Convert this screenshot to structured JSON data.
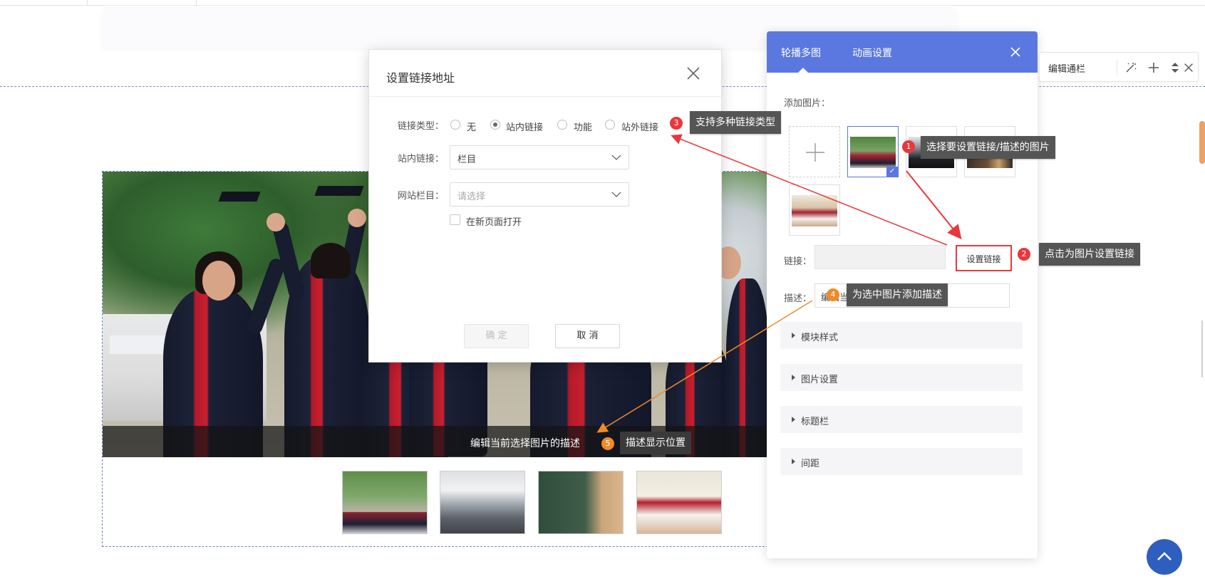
{
  "dialog": {
    "title": "设置链接地址",
    "link_type_label": "链接类型：",
    "link_types": [
      "无",
      "站内链接",
      "功能",
      "站外链接"
    ],
    "selected_link_type": "站内链接",
    "internal_link_label": "站内链接：",
    "internal_link_value": "栏目",
    "site_column_label": "网站栏目：",
    "site_column_placeholder": "请选择",
    "open_new_page_label": "在新页面打开",
    "confirm_label": "确 定",
    "cancel_label": "取 消"
  },
  "panel": {
    "tabs": [
      "轮播多图",
      "动画设置"
    ],
    "active_tab": "轮播多图",
    "add_image_label": "添加图片：",
    "link_label": "链接：",
    "set_link_button": "设置链接",
    "desc_label": "描述：",
    "desc_value": "编辑当",
    "sections": [
      "模块样式",
      "图片设置",
      "标题栏",
      "间距"
    ]
  },
  "toolbar": {
    "edit_banner_label": "编辑通栏"
  },
  "banner": {
    "caption": "编辑当前选择图片的描述"
  },
  "annotations": {
    "tip1": "选择要设置链接/描述的图片",
    "tip2": "点击为图片设置链接",
    "tip3": "支持多种链接类型",
    "tip4": "为选中图片添加描述",
    "tip5": "描述显示位置",
    "numbers": [
      "1",
      "2",
      "3",
      "4",
      "5"
    ]
  },
  "colors": {
    "accent": "#5b78e0",
    "annotation_red": "#e8383d",
    "annotation_orange": "#f08a28",
    "go_top": "#2e5fbf"
  }
}
